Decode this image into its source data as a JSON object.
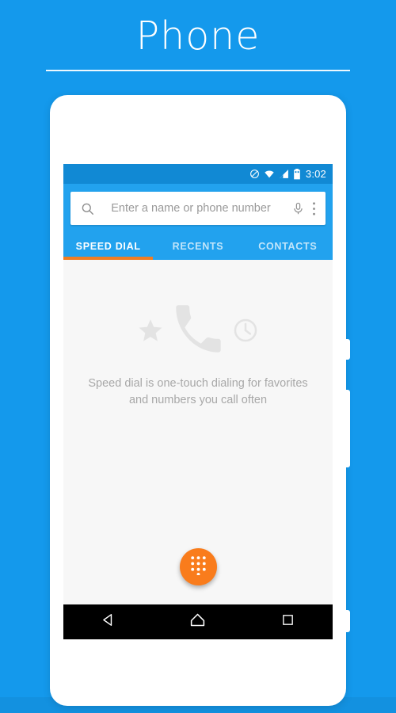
{
  "page": {
    "title": "Phone",
    "background_color": "#1499ec"
  },
  "device": {
    "body_color": "#ffffff",
    "buttons": [
      {
        "name": "power-button"
      },
      {
        "name": "volume-button"
      },
      {
        "name": "secondary-button"
      }
    ]
  },
  "status_bar": {
    "background_color": "#1189d4",
    "time": "3:02",
    "icons": [
      "do-not-disturb-icon",
      "wifi-icon",
      "cellular-signal-icon",
      "battery-icon"
    ]
  },
  "search": {
    "placeholder": "Enter a name or phone number",
    "value": "",
    "icons": {
      "leading": "search-icon",
      "voice": "microphone-icon",
      "overflow": "more-vert-icon"
    },
    "background_color": "#22a2ee"
  },
  "tabs": {
    "active_index": 0,
    "indicator_color": "#ef7d23",
    "items": [
      {
        "label": "SPEED DIAL"
      },
      {
        "label": "RECENTS"
      },
      {
        "label": "CONTACTS"
      }
    ]
  },
  "content": {
    "background_color": "#f7f7f7",
    "empty_state": {
      "message": "Speed dial is one-touch dialing for favorites and numbers you call often",
      "icons": [
        "star-icon",
        "phone-handset-icon",
        "clock-icon"
      ],
      "icon_color": "#e3e3e3",
      "text_color": "#a8a8a8"
    }
  },
  "fab": {
    "name": "dialpad-fab",
    "icon": "dialpad-icon",
    "color": "#f97c1c"
  },
  "nav_bar": {
    "background_color": "#000000",
    "buttons": [
      {
        "name": "back-button",
        "icon": "back-triangle-icon"
      },
      {
        "name": "home-button",
        "icon": "home-icon"
      },
      {
        "name": "recents-button",
        "icon": "recents-square-icon"
      }
    ]
  }
}
